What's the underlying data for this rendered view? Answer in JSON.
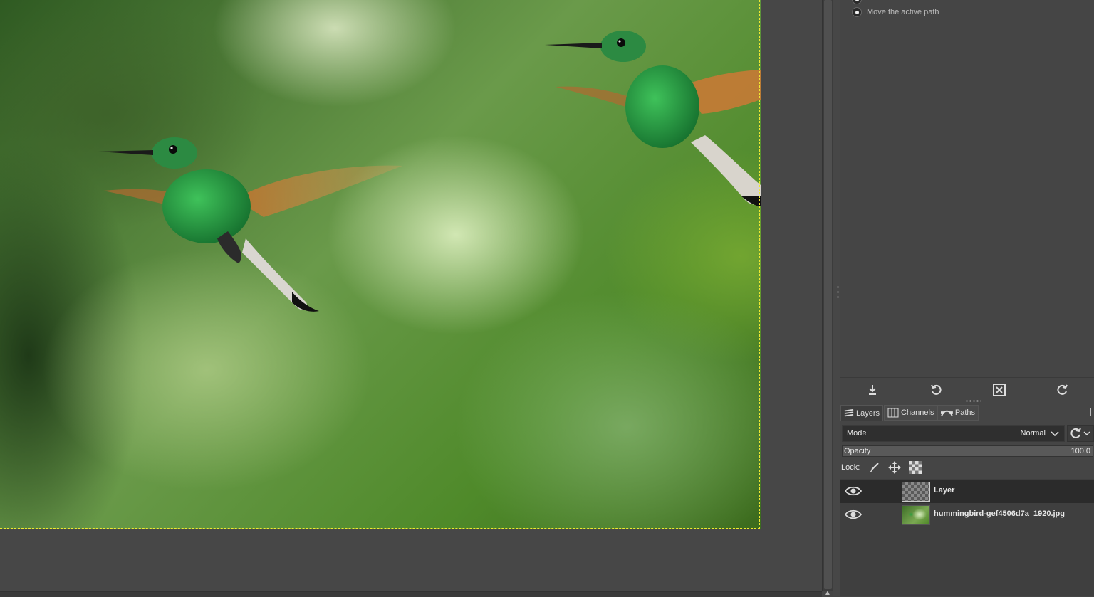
{
  "tool_options": {
    "radio_option_label": "Move the active path"
  },
  "dock": {
    "tabs": [
      {
        "label": "Layers",
        "icon": "layers-icon"
      },
      {
        "label": "Channels",
        "icon": "channels-icon"
      },
      {
        "label": "Paths",
        "icon": "paths-icon"
      }
    ]
  },
  "layers_panel": {
    "mode_label": "Mode",
    "mode_value": "Normal",
    "opacity_label": "Opacity",
    "opacity_value": "100.0",
    "lock_label": "Lock:",
    "layers": [
      {
        "name": "Layer",
        "thumbnail": "transparent",
        "visible": true,
        "selected": true
      },
      {
        "name": "hummingbird-gef4506d7a_1920.jpg",
        "thumbnail": "photo",
        "visible": true,
        "selected": false
      }
    ]
  },
  "colors": {
    "selection_marching_ants": "#f0e830",
    "panel_background": "#454545",
    "selected_row": "#2b2b2b"
  }
}
